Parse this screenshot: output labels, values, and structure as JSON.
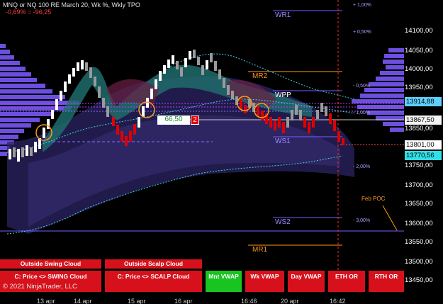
{
  "header": {
    "title": "MNQ or NQ 100 RE March 20, Wk %, Wkly TPO",
    "change": "-0,69% = -96,25"
  },
  "price_axis": {
    "labels": [
      "14100,00",
      "14050,00",
      "14000,00",
      "13950,00",
      "13850,00",
      "13750,00",
      "13700,00",
      "13650,00",
      "13600,00",
      "13550,00",
      "13500,00",
      "13450,00"
    ],
    "tags": [
      {
        "text": "13914,88",
        "color": "#5ed0ff"
      },
      {
        "text": "13867,50",
        "color": "#f3f3f3"
      },
      {
        "text": "13801,00",
        "color": "#ffffff"
      },
      {
        "text": "13770,56",
        "color": "#30e0e8"
      }
    ]
  },
  "levels": {
    "wr1": "WR1",
    "mr2": "MR2",
    "wpp": "WPP",
    "ws1": "WS1",
    "ws2": "WS2",
    "mr1": "MR1",
    "feb_poc": "Feb POC"
  },
  "pct_labels": [
    "+ 1,00%",
    "+ 0,50%",
    "- 0,50%",
    "- 1,00%",
    "- 2,00%",
    "- 3,00%"
  ],
  "price_box": {
    "value": "66,50",
    "count": "2"
  },
  "buttons": {
    "outside_swing": "Outside Swing Cloud",
    "outside_scalp": "Outside Scalp Cloud",
    "swing_cloud": "C: Price <> SWING Cloud",
    "scalp_cloud": "C: Price <> SCALP Cloud",
    "mnt_vwap": "Mnt VWAP",
    "wk_vwap": "Wk VWAP",
    "day_vwap": "Day VWAP",
    "eth_or": "ETH OR",
    "rth_or": "RTH OR"
  },
  "footer": {
    "copyright": "© 2021 NinjaTrader, LLC",
    "dates": [
      "13 apr",
      "14 apr",
      "15 apr",
      "16 apr",
      "16:46",
      "20 apr",
      "16:42"
    ]
  },
  "colors": {
    "bull": "#ffffff",
    "bear": "#e00000",
    "neutral": "#9a9a9a",
    "profile": "#7a5cff",
    "cloud": "#1f6b6b",
    "accent_red": "#d6111c",
    "accent_green": "#18c41f"
  }
}
